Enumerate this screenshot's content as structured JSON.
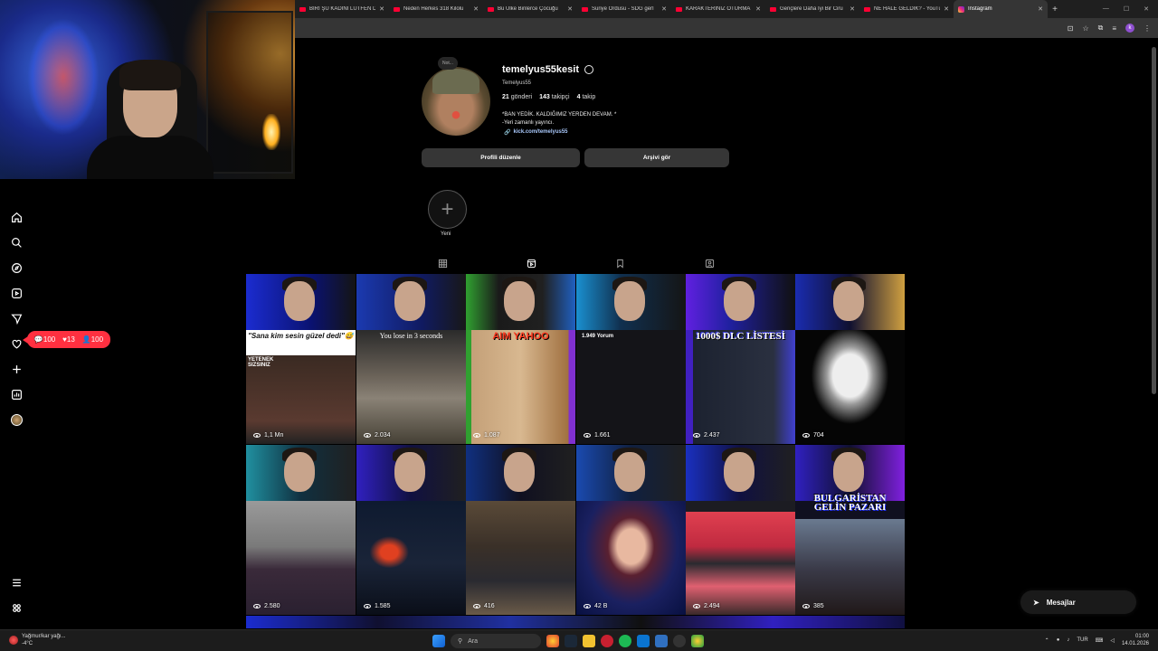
{
  "browser": {
    "tabs": [
      {
        "label": "BİRİ ŞU KADINI LÜTFEN D",
        "type": "youtube",
        "active": false
      },
      {
        "label": "Neden Herkes 318 Kilolu",
        "type": "youtube",
        "active": false
      },
      {
        "label": "Bu Ülke Binlerce Çocuğu",
        "type": "youtube",
        "active": false
      },
      {
        "label": "Suriye Ordusu - SDG gerİ",
        "type": "youtube",
        "active": false
      },
      {
        "label": "KARAKTERİNİZ OTURMA",
        "type": "youtube",
        "active": false
      },
      {
        "label": "Gençlere Daha İyi Bir Ciru",
        "type": "youtube",
        "active": false
      },
      {
        "label": "NE HALE GELDİK? - YouTu",
        "type": "youtube",
        "active": false
      },
      {
        "label": "Instagram",
        "type": "instagram",
        "active": true
      }
    ],
    "new_tab": "+",
    "profile_initial": "k"
  },
  "profile": {
    "note": "Not...",
    "username": "temelyus55kesit",
    "full_name": "Temelyus55",
    "posts_count": "21",
    "posts_label": "gönderi",
    "followers_count": "143",
    "followers_label": "takipçi",
    "following_count": "4",
    "following_label": "takip",
    "bio_line1": "*BAN YEDİK. KALDIĞIMIZ YERDEN DEVAM. *",
    "bio_line2": "-Yeri zamanlı yayıncı.",
    "link": "kick.com/temelyus55",
    "edit_button": "Profili düzenle",
    "archive_button": "Arşivi gör",
    "new_highlight_label": "Yeni"
  },
  "notifications": {
    "comments": "100",
    "likes": "13",
    "follows": "100"
  },
  "posts": [
    {
      "caption": "\"Sana kim sesin güzel dedi\"😅",
      "sub": "YETENEK SIZSINIZ",
      "views": "1,1 Mn"
    },
    {
      "caption": "You lose in 3 seconds",
      "sub": "",
      "views": "2.034"
    },
    {
      "caption": "AIM YAHOO",
      "sub": "",
      "views": "1.087"
    },
    {
      "caption": "1.949 Yorum",
      "sub": "",
      "views": "1.661"
    },
    {
      "caption": "1000$ DLC LİSTESİ",
      "sub": "",
      "views": "2.437"
    },
    {
      "caption": "",
      "sub": "",
      "views": "704"
    },
    {
      "caption": "",
      "sub": "",
      "views": "2.580"
    },
    {
      "caption": "",
      "sub": "",
      "views": "1.585"
    },
    {
      "caption": "",
      "sub": "",
      "views": "416"
    },
    {
      "caption": "",
      "sub": "",
      "views": "42 B"
    },
    {
      "caption": "",
      "sub": "",
      "views": "2.494"
    },
    {
      "caption": "BULGARİSTAN GELİN PAZARI",
      "sub": "",
      "views": "385"
    }
  ],
  "messages_label": "Mesajlar",
  "taskbar": {
    "weather_title": "Yağmur/kar yağı...",
    "weather_temp": "-4°C",
    "search_placeholder": "Ara",
    "language": "TUR",
    "time": "01:00",
    "date": "14.01.2026"
  },
  "colors": {
    "background": "#000000",
    "notification": "#ff3040",
    "link": "#a8c7fa",
    "button": "#363636"
  }
}
